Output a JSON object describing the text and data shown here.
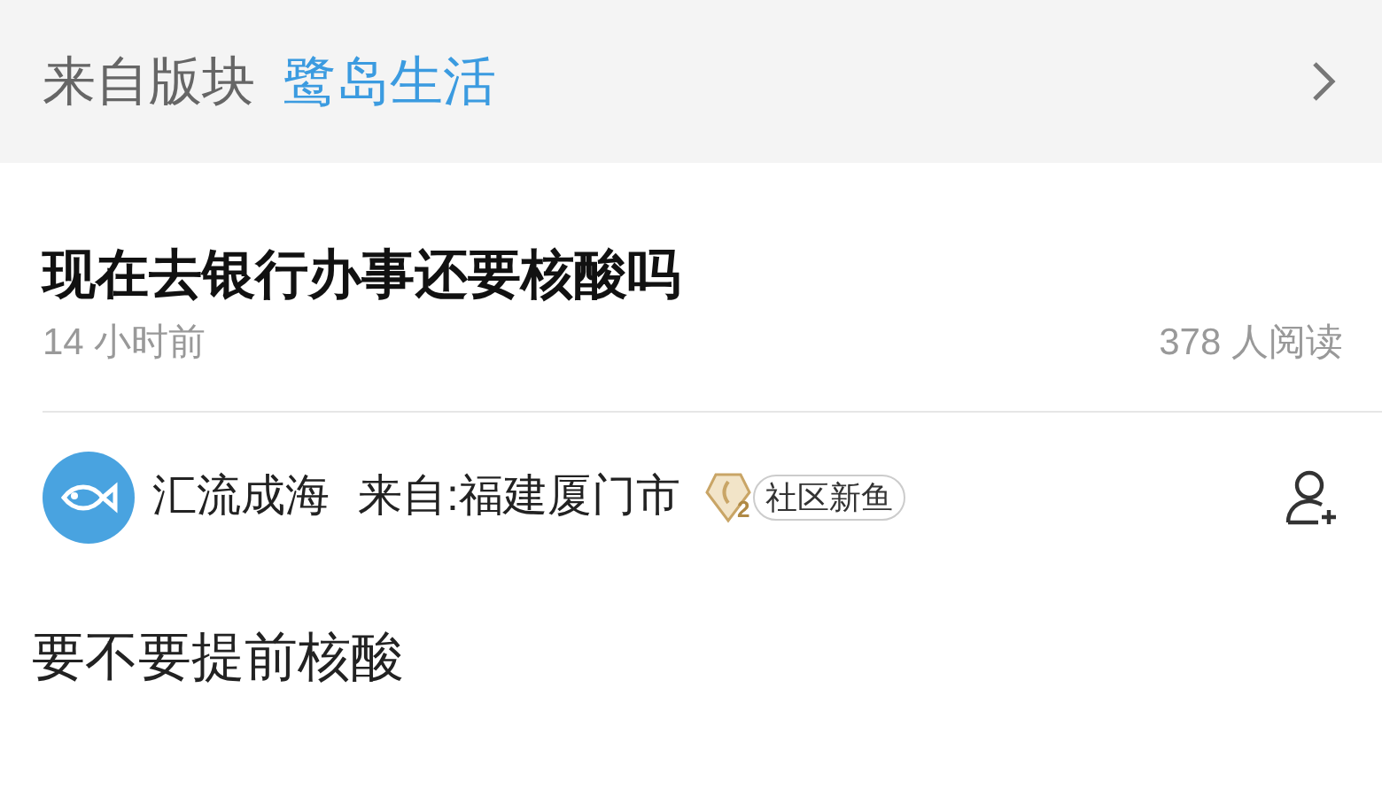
{
  "board": {
    "label": "来自版块",
    "name": "鹭岛生活"
  },
  "post": {
    "title": "现在去银行办事还要核酸吗",
    "time": "14 小时前",
    "reads": "378 人阅读"
  },
  "author": {
    "name": "汇流成海",
    "location": "来自:福建厦门市",
    "badge_level": "2",
    "badge_label": "社区新鱼"
  },
  "body": "要不要提前核酸"
}
